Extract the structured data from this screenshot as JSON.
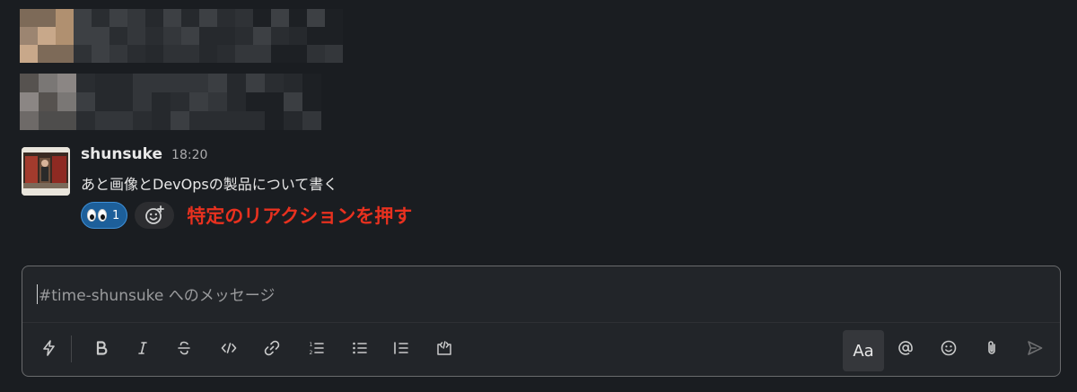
{
  "message": {
    "username": "shunsuke",
    "timestamp": "18:20",
    "text": "あと画像とDevOpsの製品について書く",
    "reaction": {
      "emoji": "eyes",
      "count": "1"
    },
    "annotation": "特定のリアクションを押す"
  },
  "composer": {
    "placeholder": "#time-shunsuke へのメッセージ",
    "format_label": "Aa"
  },
  "colors": {
    "background": "#1a1d21",
    "reaction_bg": "#1d5f9a",
    "reaction_border": "#3f90d8",
    "annotation": "#e8311f"
  },
  "icons": [
    "lightning-icon",
    "bold-icon",
    "italic-icon",
    "strikethrough-icon",
    "code-icon",
    "link-icon",
    "ordered-list-icon",
    "bullet-list-icon",
    "blockquote-icon",
    "code-block-icon",
    "mention-icon",
    "emoji-icon",
    "attachment-icon",
    "send-icon"
  ]
}
